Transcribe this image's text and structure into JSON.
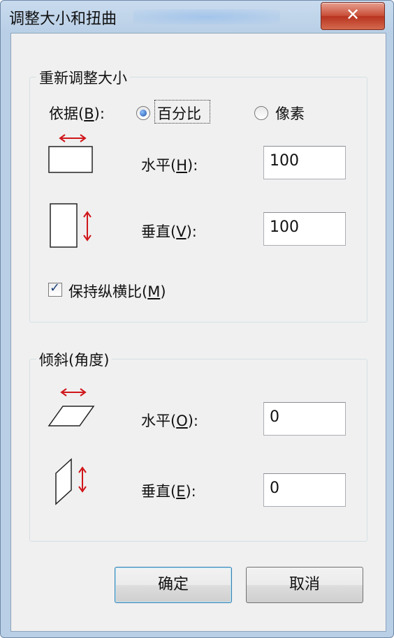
{
  "window": {
    "title": "调整大小和扭曲",
    "close_label": "✕"
  },
  "resize": {
    "group_title": "重新调整大小",
    "basis_label": "依据(B):",
    "options": [
      {
        "label": "百分比",
        "selected": true
      },
      {
        "label": "像素",
        "selected": false
      }
    ],
    "horizontal": {
      "label": "水平(H):",
      "value": "100"
    },
    "vertical": {
      "label": "垂直(V):",
      "value": "100"
    },
    "keep_ratio": {
      "label": "保持纵横比(M)",
      "checked": true
    }
  },
  "skew": {
    "group_title": "倾斜(角度)",
    "horizontal": {
      "label": "水平(O):",
      "value": "0"
    },
    "vertical": {
      "label": "垂直(E):",
      "value": "0"
    }
  },
  "buttons": {
    "ok": "确定",
    "cancel": "取消"
  },
  "colors": {
    "arrow": "#d0161a",
    "default_button_border": "#3c7fb1"
  },
  "icons": {
    "resize_h": "resize-horizontal-icon",
    "resize_v": "resize-vertical-icon",
    "skew_h": "skew-horizontal-icon",
    "skew_v": "skew-vertical-icon"
  }
}
